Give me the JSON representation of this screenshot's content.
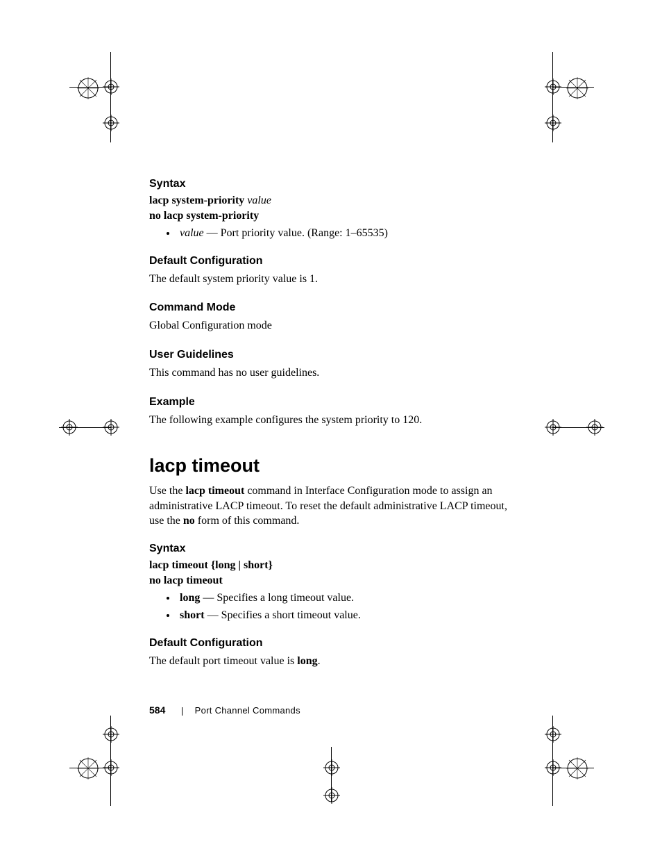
{
  "sec1": {
    "heading": "Syntax",
    "line1_bold": "lacp system-priority",
    "line1_italic": "value",
    "line2_bold": "no lacp system-priority",
    "bullet_italic": "value",
    "bullet_rest": " — Port priority value. (Range: 1–65535)"
  },
  "sec2": {
    "heading": "Default Configuration",
    "text": "The default system priority value is 1."
  },
  "sec3": {
    "heading": "Command Mode",
    "text": "Global Configuration mode"
  },
  "sec4": {
    "heading": "User Guidelines",
    "text": "This command has no user guidelines."
  },
  "sec5": {
    "heading": "Example",
    "text": "The following example configures the system priority to 120."
  },
  "cmd": {
    "title": "lacp timeout",
    "intro_a": "Use the ",
    "intro_b": "lacp timeout",
    "intro_c": " command in Interface Configuration mode to assign an administrative LACP timeout. To reset the default administrative LACP timeout, use the ",
    "intro_d": "no",
    "intro_e": " form of this command."
  },
  "sec6": {
    "heading": "Syntax",
    "line1": "lacp timeout {long | short}",
    "line2": "no lacp timeout",
    "b1_bold": "long",
    "b1_rest": " — Specifies a long timeout value.",
    "b2_bold": "short",
    "b2_rest": " — Specifies a short timeout value."
  },
  "sec7": {
    "heading": "Default Configuration",
    "text_a": "The default port timeout value is ",
    "text_b": "long",
    "text_c": "."
  },
  "footer": {
    "page": "584",
    "chapter": "Port Channel Commands"
  }
}
